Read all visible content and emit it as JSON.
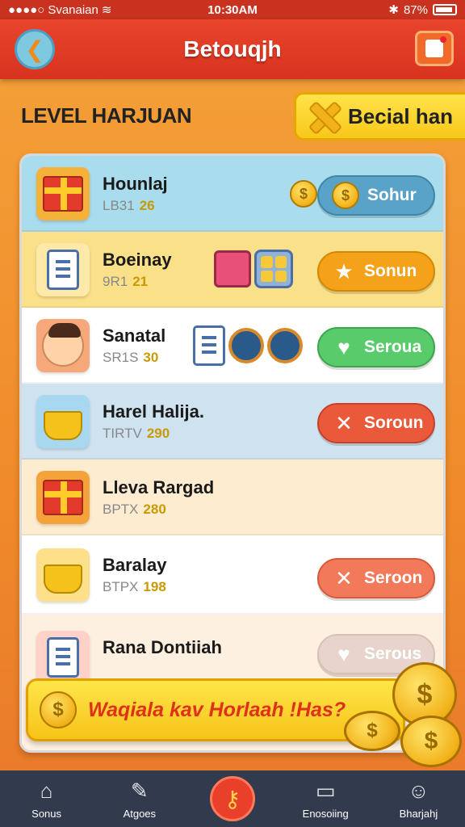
{
  "status_bar": {
    "carrier": "Svanaian",
    "time": "10:30AM",
    "battery": "87%"
  },
  "header": {
    "title": "Betouqjh"
  },
  "level_section": {
    "title": "LEVEL HARJUAN",
    "special_label": "Becial han"
  },
  "rows": [
    {
      "name": "Hounlaj",
      "code": "LB31",
      "score": "26",
      "button": "Sohur",
      "btn_color": "#5aa3c8",
      "bg": "#a9dcec",
      "icon": "gift-icon",
      "icon_bg": "#f4b23a"
    },
    {
      "name": "Boeinay",
      "code": "9R1",
      "score": "21",
      "button": "Sonun",
      "btn_color": "#f4a21a",
      "bg": "#fbe08a",
      "icon": "clipboard-icon",
      "icon_bg": "#ffe9a8"
    },
    {
      "name": "Sanatal",
      "code": "SR1S",
      "score": "30",
      "button": "Seroua",
      "btn_color": "#5acb6a",
      "bg": "#ffffff",
      "icon": "avatar-icon",
      "icon_bg": "#f6a87a"
    },
    {
      "name": "Harel Halija.",
      "code": "TIRTV",
      "score": "290",
      "button": "Soroun",
      "btn_color": "#ea5a3a",
      "bg": "#cfe2f0",
      "icon": "pot-icon",
      "icon_bg": "#a8d8f0"
    },
    {
      "name": "Lleva Rargad",
      "code": "BPTX",
      "score": "280",
      "button": "",
      "btn_color": "",
      "bg": "#fdecd0",
      "icon": "gift-icon",
      "icon_bg": "#f4a23a"
    },
    {
      "name": "Baralay",
      "code": "BTPX",
      "score": "198",
      "button": "Seroon",
      "btn_color": "#f27a5a",
      "bg": "#ffffff",
      "icon": "pot-icon",
      "icon_bg": "#ffe08a"
    },
    {
      "name": "Rana Dontiiah",
      "code": "",
      "score": "",
      "button": "Serous",
      "btn_color": "#e8d4cc",
      "bg": "#fdf0e0",
      "icon": "clipboard-icon",
      "icon_bg": "#ffd2c8"
    }
  ],
  "banner": {
    "text": "Waqiala kav Horlaah !Has?"
  },
  "bottom_nav": {
    "items": [
      {
        "label": "Sonus",
        "icon": "home-icon"
      },
      {
        "label": "Atgoes",
        "icon": "tools-icon"
      },
      {
        "label": "",
        "icon": "key-icon"
      },
      {
        "label": "Enosoiing",
        "icon": "monitor-icon"
      },
      {
        "label": "Bharjahj",
        "icon": "profile-icon"
      }
    ]
  }
}
